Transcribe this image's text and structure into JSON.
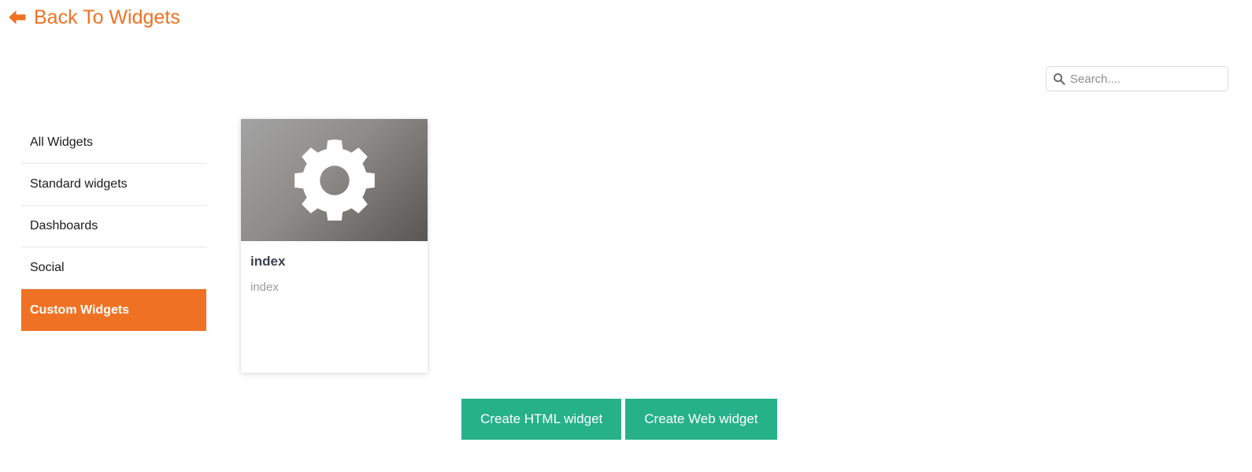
{
  "back": {
    "label": "Back To Widgets",
    "icon": "arrow-left-icon",
    "color": "#ef7224"
  },
  "search": {
    "placeholder": "Search....",
    "value": "",
    "icon": "search-icon"
  },
  "sidebar": {
    "items": [
      {
        "label": "All Widgets",
        "active": false
      },
      {
        "label": "Standard widgets",
        "active": false
      },
      {
        "label": "Dashboards",
        "active": false
      },
      {
        "label": "Social",
        "active": false
      },
      {
        "label": "Custom Widgets",
        "active": true
      }
    ],
    "active_color": "#ef7224"
  },
  "widgets": [
    {
      "title": "index",
      "subtitle": "index",
      "thumbnail_icon": "gear-icon"
    }
  ],
  "actions": {
    "create_html_label": "Create HTML widget",
    "create_web_label": "Create Web widget",
    "button_color": "#26b189"
  }
}
